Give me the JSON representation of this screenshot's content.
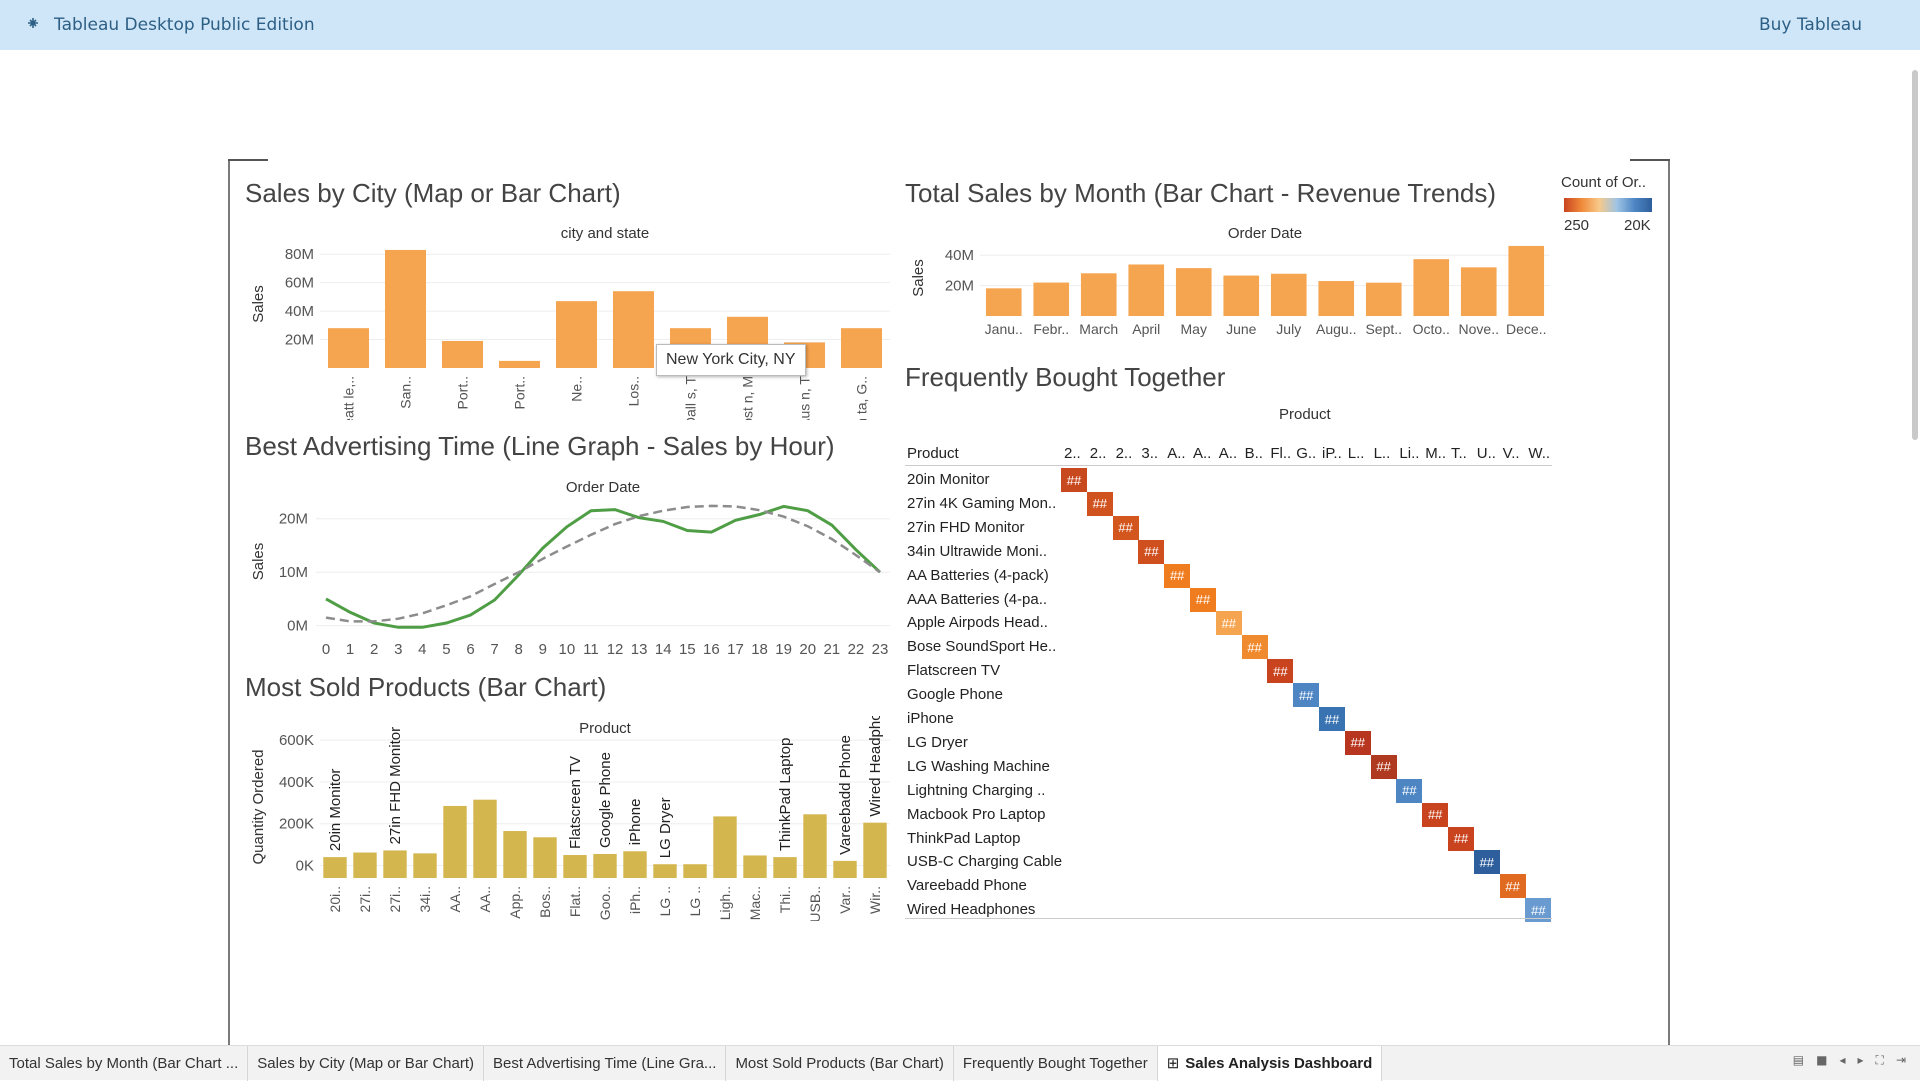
{
  "topbar": {
    "brand": "Tableau Desktop Public Edition",
    "buy": "Buy Tableau",
    "icon": "tableau-logo-icon"
  },
  "titles": {
    "city": "Sales by City (Map or Bar Chart)",
    "month": "Total Sales by Month (Bar Chart - Revenue Trends)",
    "hour": "Best Advertising Time (Line Graph - Sales by Hour)",
    "products": "Most Sold Products (Bar Chart)",
    "together": "Frequently Bought Together"
  },
  "tooltip": "New York City, NY",
  "legend": {
    "title": "Count of Or..",
    "min": "250",
    "max": "20K",
    "colors": [
      "#c94420",
      "#f08a3a",
      "#f7c98a",
      "#9fc4e4",
      "#4e86c4",
      "#2e5f9c"
    ]
  },
  "tabs": [
    {
      "label": "Total Sales by Month (Bar Chart ..."
    },
    {
      "label": "Sales by City (Map or Bar Chart)"
    },
    {
      "label": "Best Advertising Time (Line Gra..."
    },
    {
      "label": "Most Sold Products (Bar Chart)"
    },
    {
      "label": "Frequently Bought Together"
    },
    {
      "label": "Sales Analysis Dashboard",
      "icon": "dashboard-grid-icon",
      "active": true
    }
  ],
  "chart_data": [
    {
      "id": "city",
      "type": "bar",
      "title": "Sales by City (Map or Bar Chart)",
      "xlabel": "city and state",
      "ylabel": "Sales",
      "yticks": [
        "20M",
        "40M",
        "60M",
        "80M"
      ],
      "ytick_values": [
        20,
        40,
        60,
        80
      ],
      "ylim": [
        0,
        90
      ],
      "color": "#f5a44f",
      "categories": [
        "Seatt le,..",
        "San..",
        "Port..",
        "Port..",
        "Ne..",
        "Los..",
        "Dall s, T",
        "Bost n, M",
        "Aus n, T",
        "Atlan ta, G.."
      ],
      "values": [
        28,
        83,
        19,
        5,
        47,
        54,
        28,
        36,
        18,
        28
      ]
    },
    {
      "id": "month",
      "type": "bar",
      "title": "Total Sales by Month (Bar Chart - Revenue Trends)",
      "xlabel": "Order Date",
      "ylabel": "Sales",
      "yticks": [
        "20M",
        "40M"
      ],
      "ytick_values": [
        20,
        40
      ],
      "ylim": [
        0,
        50
      ],
      "color": "#f5a44f",
      "categories": [
        "Janu..",
        "Febr..",
        "March",
        "April",
        "May",
        "June",
        "July",
        "Augu..",
        "Sept..",
        "Octo..",
        "Nove..",
        "Dece.."
      ],
      "values": [
        18.2,
        22,
        28.1,
        33.9,
        31.5,
        26.6,
        27.8,
        23,
        21.9,
        37.4,
        32,
        46.1
      ]
    },
    {
      "id": "hour",
      "type": "line",
      "title": "Best Advertising Time (Line Graph - Sales by Hour)",
      "xlabel": "Order Date",
      "ylabel": "Sales",
      "yticks": [
        "0M",
        "10M",
        "20M"
      ],
      "ytick_values": [
        0,
        10,
        20
      ],
      "ylim": [
        -1,
        25
      ],
      "x": [
        "0",
        "1",
        "2",
        "3",
        "4",
        "5",
        "6",
        "7",
        "8",
        "9",
        "10",
        "11",
        "12",
        "13",
        "14",
        "15",
        "16",
        "17",
        "18",
        "19",
        "20",
        "21",
        "22",
        "23"
      ],
      "series": [
        {
          "values": [
            5,
            2.5,
            0.5,
            -0.3,
            -0.3,
            0.5,
            2,
            4.8,
            9.5,
            14.5,
            18.5,
            21.5,
            21.7,
            20.2,
            19.5,
            17.8,
            17.5,
            19.7,
            20.8,
            22.3,
            21.5,
            18.8,
            14.2,
            10
          ],
          "color": "#4f9e45",
          "dash": false
        },
        {
          "values": [
            1.5,
            0.8,
            0.8,
            1.3,
            2.3,
            3.8,
            5.5,
            7.8,
            10,
            12.5,
            14.8,
            17,
            19,
            20.5,
            21.5,
            22.2,
            22.4,
            22.3,
            21.6,
            20.4,
            18.6,
            16.2,
            13.2,
            10
          ],
          "color": "#8c8c8c",
          "dash": true
        }
      ]
    },
    {
      "id": "products",
      "type": "bar",
      "title": "Most Sold Products (Bar Chart)",
      "xlabel": "Product",
      "ylabel": "Quantity Ordered",
      "yticks": [
        "0K",
        "200K",
        "400K",
        "600K"
      ],
      "ytick_values": [
        0,
        200,
        400,
        600
      ],
      "ylim": [
        -60,
        620
      ],
      "color": "#d4b64f",
      "categories": [
        "20i..",
        "27i..",
        "27i..",
        "34i..",
        "AA..",
        "AA..",
        "App..",
        "Bos..",
        "Flat..",
        "Goo..",
        "iPh..",
        "LG ..",
        "LG ..",
        "Ligh..",
        "Mac..",
        "Thi..",
        "USB..",
        "Var..",
        "Wir.."
      ],
      "values": [
        40,
        62,
        72,
        58,
        285,
        315,
        165,
        135,
        50,
        55,
        68,
        6,
        6,
        235,
        48,
        40,
        245,
        22,
        205
      ],
      "inner_labels": [
        "20in Monitor",
        "",
        "27in FHD Monitor",
        "",
        "",
        "",
        "",
        "",
        "Flatscreen TV",
        "Google Phone",
        "iPhone",
        "LG Dryer",
        "",
        "",
        "",
        "ThinkPad Laptop",
        "",
        "Vareebadd Phone",
        "Wired Headphones"
      ]
    },
    {
      "id": "together",
      "type": "heatmap",
      "title": "Frequently Bought Together",
      "column_header": "Product",
      "row_header": "Product",
      "columns": [
        "2..",
        "2..",
        "2..",
        "3..",
        "A..",
        "A..",
        "A..",
        "B..",
        "Fl..",
        "G..",
        "iP..",
        "L..",
        "L..",
        "Li..",
        "M..",
        "T..",
        "U..",
        "V..",
        "W.."
      ],
      "rows": [
        "20in Monitor",
        "27in 4K Gaming Mon..",
        "27in FHD Monitor",
        "34in Ultrawide Moni..",
        "AA Batteries (4-pack)",
        "AAA Batteries (4-pa..",
        "Apple Airpods Head..",
        "Bose SoundSport He..",
        "Flatscreen TV",
        "Google Phone",
        "iPhone",
        "LG Dryer",
        "LG Washing Machine",
        "Lightning Charging ..",
        "Macbook Pro Laptop",
        "ThinkPad Laptop",
        "USB-C Charging Cable",
        "Vareebadd Phone",
        "Wired Headphones"
      ],
      "cell_text": "##",
      "cell_colors": [
        "#c9491f",
        "#d0521f",
        "#d4561f",
        "#cf4f1f",
        "#ef7d1f",
        "#ef7d1f",
        "#f5a44f",
        "#f08a2f",
        "#c9431f",
        "#4e86c4",
        "#3a73b2",
        "#b8361f",
        "#b03a1f",
        "#4e86c4",
        "#c9431f",
        "#c9431f",
        "#2e5f9c",
        "#e06a1f",
        "#6a9bd0"
      ]
    }
  ]
}
